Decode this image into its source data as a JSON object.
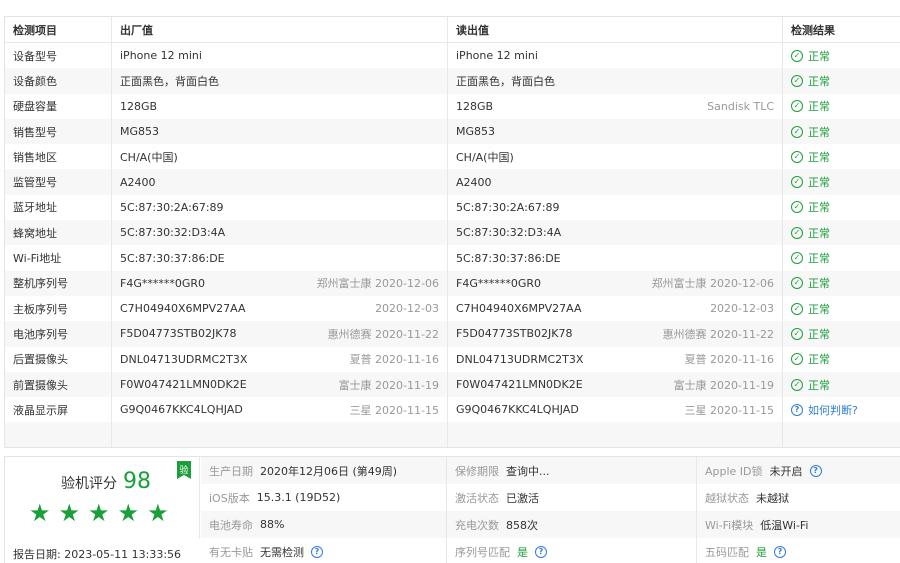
{
  "table": {
    "headers": [
      "检测项目",
      "出厂值",
      "读出值",
      "检测结果"
    ],
    "rows": [
      {
        "item": "设备型号",
        "factory": "iPhone 12 mini",
        "factory_note": "",
        "read": "iPhone 12 mini",
        "read_note": "",
        "result": "正常",
        "status": "ok"
      },
      {
        "item": "设备颜色",
        "factory": "正面黑色，背面白色",
        "factory_note": "",
        "read": "正面黑色，背面白色",
        "read_note": "",
        "result": "正常",
        "status": "ok"
      },
      {
        "item": "硬盘容量",
        "factory": "128GB",
        "factory_note": "",
        "read": "128GB",
        "read_note": "Sandisk TLC",
        "result": "正常",
        "status": "ok"
      },
      {
        "item": "销售型号",
        "factory": "MG853",
        "factory_note": "",
        "read": "MG853",
        "read_note": "",
        "result": "正常",
        "status": "ok"
      },
      {
        "item": "销售地区",
        "factory": "CH/A(中国)",
        "factory_note": "",
        "read": "CH/A(中国)",
        "read_note": "",
        "result": "正常",
        "status": "ok"
      },
      {
        "item": "监管型号",
        "factory": "A2400",
        "factory_note": "",
        "read": "A2400",
        "read_note": "",
        "result": "正常",
        "status": "ok"
      },
      {
        "item": "蓝牙地址",
        "factory": "5C:87:30:2A:67:89",
        "factory_note": "",
        "read": "5C:87:30:2A:67:89",
        "read_note": "",
        "result": "正常",
        "status": "ok"
      },
      {
        "item": "蜂窝地址",
        "factory": "5C:87:30:32:D3:4A",
        "factory_note": "",
        "read": "5C:87:30:32:D3:4A",
        "read_note": "",
        "result": "正常",
        "status": "ok"
      },
      {
        "item": "Wi-Fi地址",
        "factory": "5C:87:30:37:86:DE",
        "factory_note": "",
        "read": "5C:87:30:37:86:DE",
        "read_note": "",
        "result": "正常",
        "status": "ok"
      },
      {
        "item": "整机序列号",
        "factory": "F4G******0GR0",
        "factory_note": "郑州富士康 2020-12-06",
        "read": "F4G******0GR0",
        "read_note": "郑州富士康 2020-12-06",
        "result": "正常",
        "status": "ok"
      },
      {
        "item": "主板序列号",
        "factory": "C7H04940X6MPV27AA",
        "factory_note": "2020-12-03",
        "read": "C7H04940X6MPV27AA",
        "read_note": "2020-12-03",
        "result": "正常",
        "status": "ok"
      },
      {
        "item": "电池序列号",
        "factory": "F5D04773STB02JK78",
        "factory_note": "惠州德赛 2020-11-22",
        "read": "F5D04773STB02JK78",
        "read_note": "惠州德赛 2020-11-22",
        "result": "正常",
        "status": "ok"
      },
      {
        "item": "后置摄像头",
        "factory": "DNL04713UDRMC2T3X",
        "factory_note": "夏普 2020-11-16",
        "read": "DNL04713UDRMC2T3X",
        "read_note": "夏普 2020-11-16",
        "result": "正常",
        "status": "ok"
      },
      {
        "item": "前置摄像头",
        "factory": "F0W047421LMN0DK2E",
        "factory_note": "富士康 2020-11-19",
        "read": "F0W047421LMN0DK2E",
        "read_note": "富士康 2020-11-19",
        "result": "正常",
        "status": "ok"
      },
      {
        "item": "液晶显示屏",
        "factory": "G9Q0467KKC4LQHJAD",
        "factory_note": "三星 2020-11-15",
        "read": "G9Q0467KKC4LQHJAD",
        "read_note": "三星 2020-11-15",
        "result": "如何判断?",
        "status": "ask"
      }
    ]
  },
  "summary": {
    "score_label": "验机评分",
    "score": "98",
    "badge": "验",
    "stars": 5,
    "report_label": "报告日期:",
    "report_date": "2023-05-11 13:33:56",
    "rows": [
      [
        {
          "label": "生产日期",
          "value": "2020年12月06日 (第49周)",
          "green": false,
          "help": false
        },
        {
          "label": "保修期限",
          "value": "查询中...",
          "green": false,
          "help": false
        },
        {
          "label": "Apple ID锁",
          "value": "未开启",
          "green": false,
          "help": true
        }
      ],
      [
        {
          "label": "iOS版本",
          "value": "15.3.1 (19D52)",
          "green": false,
          "help": false
        },
        {
          "label": "激活状态",
          "value": "已激活",
          "green": false,
          "help": false
        },
        {
          "label": "越狱状态",
          "value": "未越狱",
          "green": false,
          "help": false
        }
      ],
      [
        {
          "label": "电池寿命",
          "value": "88%",
          "green": false,
          "help": false
        },
        {
          "label": "充电次数",
          "value": "858次",
          "green": false,
          "help": false
        },
        {
          "label": "Wi-Fi模块",
          "value": "低温Wi-Fi",
          "green": false,
          "help": false
        }
      ],
      [
        {
          "label": "有无卡贴",
          "value": "无需检测",
          "green": false,
          "help": true
        },
        {
          "label": "序列号匹配",
          "value": "是",
          "green": true,
          "help": true
        },
        {
          "label": "五码匹配",
          "value": "是",
          "green": true,
          "help": true
        }
      ]
    ]
  },
  "colors": {
    "accent_green": "#1a9f3a",
    "link_blue": "#2f7ddc",
    "muted": "#999999"
  },
  "icons": {
    "ok": "check-circle-icon",
    "ask": "question-circle-icon",
    "star": "star-icon"
  }
}
